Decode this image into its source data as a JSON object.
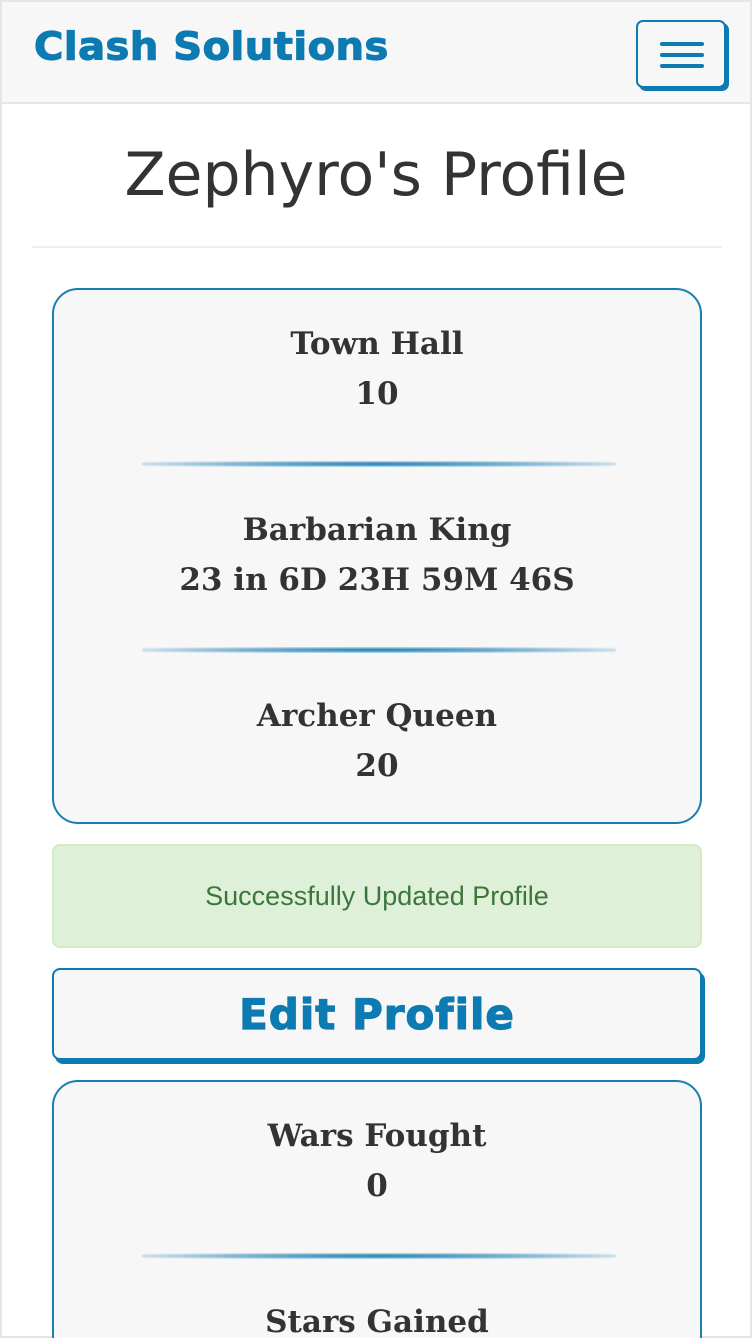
{
  "navbar": {
    "brand": "Clash Solutions",
    "menu_icon": "hamburger-menu-icon"
  },
  "page": {
    "title": "Zephyro's Profile"
  },
  "heroes_card": {
    "stats": [
      {
        "label": "Town Hall",
        "value": "10"
      },
      {
        "label": "Barbarian King",
        "value": "23 in 6D 23H 59M 46S"
      },
      {
        "label": "Archer Queen",
        "value": "20"
      }
    ]
  },
  "alert": {
    "message": "Successfully Updated Profile"
  },
  "actions": {
    "edit_profile": "Edit Profile"
  },
  "wars_card": {
    "stats": [
      {
        "label": "Wars Fought",
        "value": "0"
      },
      {
        "label": "Stars Gained",
        "value": ""
      }
    ]
  },
  "colors": {
    "brand": "#0d7ab2",
    "card_border": "#1a7fb0",
    "card_bg": "#f7f7f7",
    "alert_bg": "#dff0d8",
    "alert_text": "#3c763d",
    "text": "#333333"
  }
}
